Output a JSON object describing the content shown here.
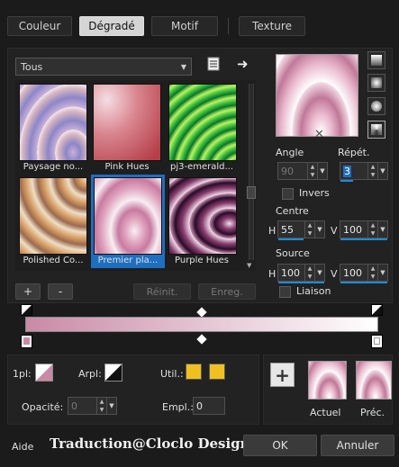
{
  "tabs": [
    "Couleur",
    "Dégradé",
    "Motif",
    "Texture"
  ],
  "preset_select": {
    "value": "Tous"
  },
  "presets": [
    {
      "name": "Paysage no..."
    },
    {
      "name": "Pink Hues"
    },
    {
      "name": "pj3-emerald..."
    },
    {
      "name": "Polished Co..."
    },
    {
      "name": "Premier pla...",
      "selected": true
    },
    {
      "name": "Purple Hues"
    }
  ],
  "angle": {
    "label": "Angle",
    "value": "90"
  },
  "repet": {
    "label": "Répét.",
    "value": "3"
  },
  "invers": {
    "label": "Invers"
  },
  "centre": {
    "label": "Centre",
    "h_label": "H",
    "h": "55",
    "v_label": "V",
    "v": "100"
  },
  "source": {
    "label": "Source",
    "h_label": "H",
    "h": "100",
    "v_label": "V",
    "v": "100"
  },
  "liaison": {
    "label": "Liaison"
  },
  "buttons": {
    "add": "+",
    "remove": "-",
    "reinit": "Réinit.",
    "enreg": "Enreg."
  },
  "bottom": {
    "pl1_label": "1pl:",
    "arpl_label": "Arpl:",
    "util_label": "Util.:",
    "opacite_label": "Opacité:",
    "opacite_value": "0",
    "empl_label": "Empl.:",
    "empl_value": "0"
  },
  "previews": {
    "actuel": "Actuel",
    "prec": "Préc."
  },
  "footer": {
    "aide": "Aide",
    "watermark": "Traduction@Cloclo Design",
    "ok": "OK",
    "annuler": "Annuler"
  },
  "colors": {
    "accent": "#1e8ad6",
    "pink": "#c98aa6",
    "yellow": "#f0c020",
    "selected_bg": "#1e6fc0"
  }
}
